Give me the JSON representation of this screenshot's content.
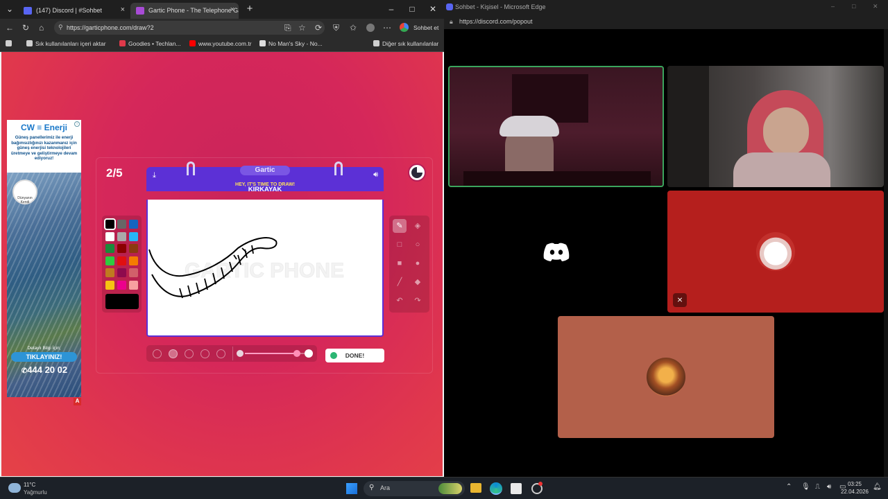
{
  "left_browser": {
    "tabs": [
      {
        "title": "(147) Discord | #Sohbet",
        "icon_color": "#5865f2"
      },
      {
        "title": "Gartic Phone - The Telephone Game",
        "icon_color": "#a84bd6"
      }
    ],
    "url": "https://garticphone.com/draw?2",
    "profile_label": "Sohbet et",
    "bookmarks": [
      {
        "label": "Sık kullanılanları içeri aktar",
        "icon_color": "#cfcfcf"
      },
      {
        "label": "Goodies • Techlan...",
        "icon_color": "#e0394a"
      },
      {
        "label": "www.youtube.com.tr",
        "icon_color": "#ff0000"
      },
      {
        "label": "No Man's Sky - No...",
        "icon_color": "#dddddd"
      },
      {
        "label": "Diğer sık kullanılanlar",
        "icon_color": "#cfcfcf"
      }
    ]
  },
  "ad": {
    "brand": "CW ≡ Enerji",
    "description": "Güneş panellerimiz ile enerji bağımsızlığınızı kazanmanız için güneş enerjisi teknolojileri üretmeye ve geliştirmeye devam ediyoruz!",
    "badge": "Dünyanın Kendi",
    "cta_top": "Detaylı Bilgi İçin;",
    "cta": "TIKLAYINIZ!",
    "phone": "444 20 02",
    "marker": "A"
  },
  "game": {
    "round": "2/5",
    "brand": "Gartic",
    "prompt": "HEY, IT'S TIME TO DRAW!",
    "word": "KIRKAYAK",
    "done_label": "DONE!",
    "watermark": "GARTIC PHONE",
    "timer_elapsed_fraction": 0.75,
    "brush_size_fraction": 0.85,
    "selected_color": "#000000",
    "colors": [
      "#000000",
      "#666666",
      "#1565c0",
      "#ffffff",
      "#aaaaaa",
      "#29b6f6",
      "#1b8a3a",
      "#8b0000",
      "#8b3a0f",
      "#2ecc40",
      "#e01010",
      "#f57c00",
      "#c07a20",
      "#8e0b4d",
      "#d1606a",
      "#f6c312",
      "#ec008c",
      "#f7a0a0"
    ],
    "tools": [
      "pencil-icon",
      "eraser-icon",
      "rectangle-icon",
      "ellipse-icon",
      "filled-rectangle-icon",
      "filled-ellipse-icon",
      "line-icon",
      "fill-icon",
      "undo-icon",
      "redo-icon"
    ]
  },
  "discord": {
    "window_title": "Sohbet - Kişisel - Microsoft Edge",
    "url": "https://discord.com/popout",
    "tiles": [
      {
        "name": "participant-1-video",
        "speaking": true
      },
      {
        "name": "participant-2-video",
        "speaking": false
      },
      {
        "name": "participant-3-avatar",
        "avatar": "discord-logo"
      },
      {
        "name": "participant-4-avatar",
        "muted": true,
        "bg": "#b51f1d"
      },
      {
        "name": "participant-5-avatar",
        "bg": "#b3604a"
      }
    ]
  },
  "taskbar": {
    "temperature": "11°C",
    "weather": "Yağmurlu",
    "search_placeholder": "Ara",
    "time": "03:25",
    "date": "22.04.2026"
  }
}
